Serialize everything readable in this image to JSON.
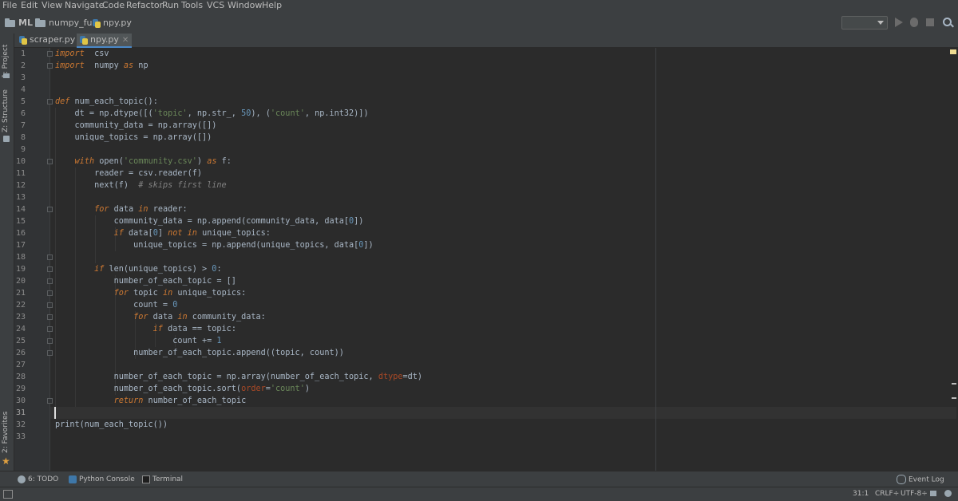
{
  "menu": [
    "File",
    "Edit",
    "View",
    "Navigate",
    "Code",
    "Refactor",
    "Run",
    "Tools",
    "VCS",
    "Window",
    "Help"
  ],
  "breadcrumbs": [
    "ML",
    "numpy_fun",
    "npy.py"
  ],
  "tabs": [
    {
      "label": "scraper.py",
      "active": false
    },
    {
      "label": "npy.py",
      "active": true
    }
  ],
  "side_tabs": {
    "project": "1: Project",
    "structure": "Z: Structure",
    "favorites": "2: Favorites"
  },
  "editor": {
    "line_numbers": [
      "1",
      "2",
      "3",
      "4",
      "5",
      "6",
      "7",
      "8",
      "9",
      "10",
      "11",
      "12",
      "13",
      "14",
      "15",
      "16",
      "17",
      "18",
      "19",
      "20",
      "21",
      "22",
      "23",
      "24",
      "25",
      "26",
      "27",
      "28",
      "29",
      "30",
      "31",
      "32",
      "33"
    ],
    "current_line": 31
  },
  "bottom_tools": {
    "todo": "6: TODO",
    "python_console": "Python Console",
    "terminal": "Terminal",
    "event_log": "Event Log"
  },
  "status": {
    "position": "31:1",
    "line_sep": "CRLF",
    "encoding": "UTF-8"
  },
  "colors": {
    "keyword": "#cc7832",
    "string": "#6a8759",
    "number": "#6897bb",
    "comment": "#808080",
    "background": "#2b2b2b"
  },
  "icons": [
    "folder-icon",
    "python-file-icon",
    "run-icon",
    "debug-icon",
    "stop-icon",
    "search-icon",
    "todo-icon",
    "console-icon",
    "terminal-icon",
    "event-log-icon",
    "lock-icon"
  ]
}
